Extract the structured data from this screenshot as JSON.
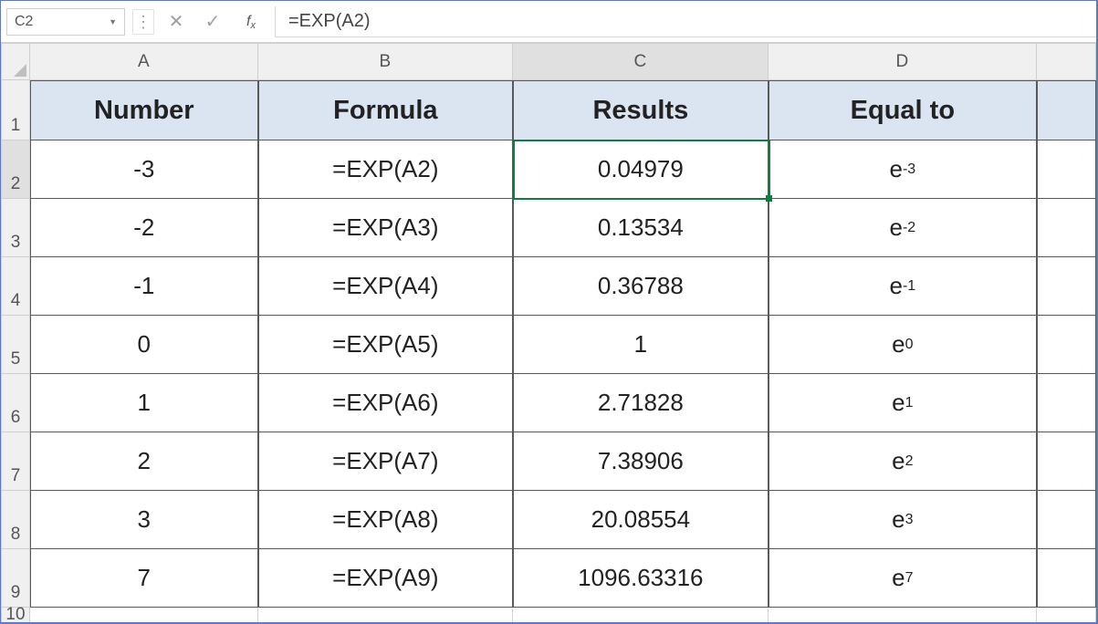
{
  "formula_bar": {
    "name_box_value": "C2",
    "formula_text": "=EXP(A2)"
  },
  "columns": {
    "labels": [
      "A",
      "B",
      "C",
      "D",
      ""
    ],
    "widths": [
      250,
      280,
      280,
      295,
      65
    ],
    "selected_index": 2
  },
  "rows": {
    "labels": [
      "1",
      "2",
      "3",
      "4",
      "5",
      "6",
      "7",
      "8",
      "9",
      "10"
    ],
    "heights": [
      66,
      64,
      64,
      64,
      64,
      64,
      64,
      64,
      64,
      24
    ],
    "selected_index": 1
  },
  "headers": [
    "Number",
    "Formula",
    "Results",
    "Equal to"
  ],
  "data_rows": [
    {
      "number": "-3",
      "formula": "=EXP(A2)",
      "result": "0.04979",
      "equal_base": "e",
      "equal_exp": "-3"
    },
    {
      "number": "-2",
      "formula": "=EXP(A3)",
      "result": "0.13534",
      "equal_base": "e",
      "equal_exp": "-2"
    },
    {
      "number": "-1",
      "formula": "=EXP(A4)",
      "result": "0.36788",
      "equal_base": "e",
      "equal_exp": "-1"
    },
    {
      "number": "0",
      "formula": "=EXP(A5)",
      "result": "1",
      "equal_base": "e",
      "equal_exp": "0"
    },
    {
      "number": "1",
      "formula": "=EXP(A6)",
      "result": "2.71828",
      "equal_base": "e",
      "equal_exp": "1"
    },
    {
      "number": "2",
      "formula": "=EXP(A7)",
      "result": "7.38906",
      "equal_base": "e",
      "equal_exp": "2"
    },
    {
      "number": "3",
      "formula": "=EXP(A8)",
      "result": "20.08554",
      "equal_base": "e",
      "equal_exp": "3"
    },
    {
      "number": "7",
      "formula": "=EXP(A9)",
      "result": "1096.63316",
      "equal_base": "e",
      "equal_exp": "7"
    }
  ],
  "selected_cell": {
    "row_index": 1,
    "col_index": 2
  },
  "chart_data": {
    "type": "table",
    "title": "EXP function examples",
    "columns": [
      "Number",
      "Formula",
      "Results",
      "Equal to"
    ],
    "rows": [
      [
        "-3",
        "=EXP(A2)",
        "0.04979",
        "e^-3"
      ],
      [
        "-2",
        "=EXP(A3)",
        "0.13534",
        "e^-2"
      ],
      [
        "-1",
        "=EXP(A4)",
        "0.36788",
        "e^-1"
      ],
      [
        "0",
        "=EXP(A5)",
        "1",
        "e^0"
      ],
      [
        "1",
        "=EXP(A6)",
        "2.71828",
        "e^1"
      ],
      [
        "2",
        "=EXP(A7)",
        "7.38906",
        "e^2"
      ],
      [
        "3",
        "=EXP(A8)",
        "20.08554",
        "e^3"
      ],
      [
        "7",
        "=EXP(A9)",
        "1096.63316",
        "e^7"
      ]
    ]
  }
}
